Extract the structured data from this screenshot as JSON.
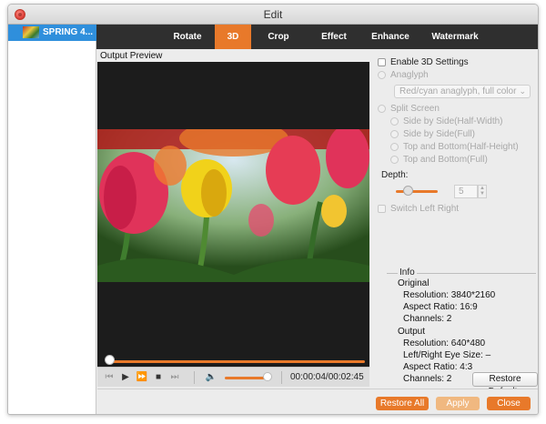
{
  "window": {
    "title": "Edit"
  },
  "sidebar": {
    "file": {
      "name": "SPRING 4..."
    }
  },
  "tabs": [
    {
      "label": "Rotate",
      "active": false
    },
    {
      "label": "3D",
      "active": true
    },
    {
      "label": "Crop",
      "active": false
    },
    {
      "label": "Effect",
      "active": false
    },
    {
      "label": "Enhance",
      "active": false
    },
    {
      "label": "Watermark",
      "active": false
    }
  ],
  "preview": {
    "label": "Output Preview",
    "time": "00:00:04/00:02:45",
    "progress_fraction": 0.02,
    "volume_fraction": 0.85
  },
  "settings": {
    "enable_3d": {
      "label": "Enable 3D Settings",
      "checked": false
    },
    "anaglyph": {
      "label": "Anaglyph",
      "value": "Red/cyan anaglyph, full color"
    },
    "split_screen": {
      "label": "Split Screen",
      "options": [
        "Side by Side(Half-Width)",
        "Side by Side(Full)",
        "Top and Bottom(Half-Height)",
        "Top and Bottom(Full)"
      ]
    },
    "depth": {
      "label": "Depth:",
      "value": "5"
    },
    "switch_lr": {
      "label": "Switch Left Right"
    }
  },
  "info": {
    "title": "Info",
    "original": {
      "heading": "Original",
      "resolution": "Resolution: 3840*2160",
      "aspect": "Aspect Ratio: 16:9",
      "channels": "Channels: 2"
    },
    "output": {
      "heading": "Output",
      "resolution": "Resolution: 640*480",
      "eye_size": "Left/Right Eye Size: –",
      "aspect": "Aspect Ratio: 4:3",
      "channels": "Channels: 2"
    }
  },
  "buttons": {
    "restore_defaults": "Restore Defaults",
    "restore_all": "Restore All",
    "apply": "Apply",
    "close": "Close"
  },
  "colors": {
    "accent": "#e8792a",
    "tab_bar": "#2f2f2f",
    "selection": "#2f8fdc",
    "apply_disabled": "#f0b880"
  }
}
